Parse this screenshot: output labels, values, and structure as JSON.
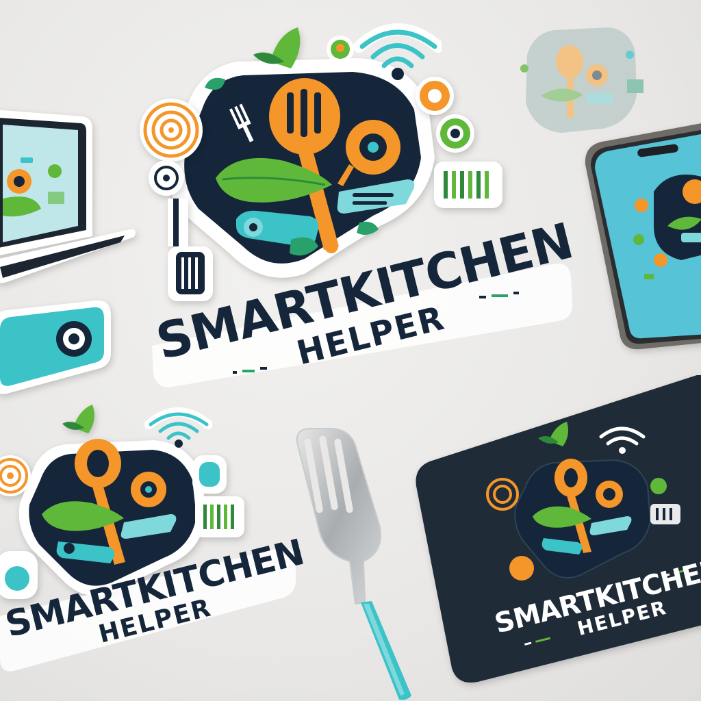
{
  "brand": {
    "line1": "SMARTKITCHEN",
    "line2": "HELPER"
  },
  "colors": {
    "navy": "#15263a",
    "orange": "#f5962a",
    "green": "#5fb83a",
    "teal": "#3cc3c8",
    "light_teal": "#7fd8dc",
    "background": "#eceae8"
  },
  "icons": [
    "spatula-icon",
    "leaf-icon",
    "pan-icon",
    "fork-icon",
    "wifi-icon",
    "spiral-icon",
    "toggle-icon",
    "knife-icon"
  ]
}
